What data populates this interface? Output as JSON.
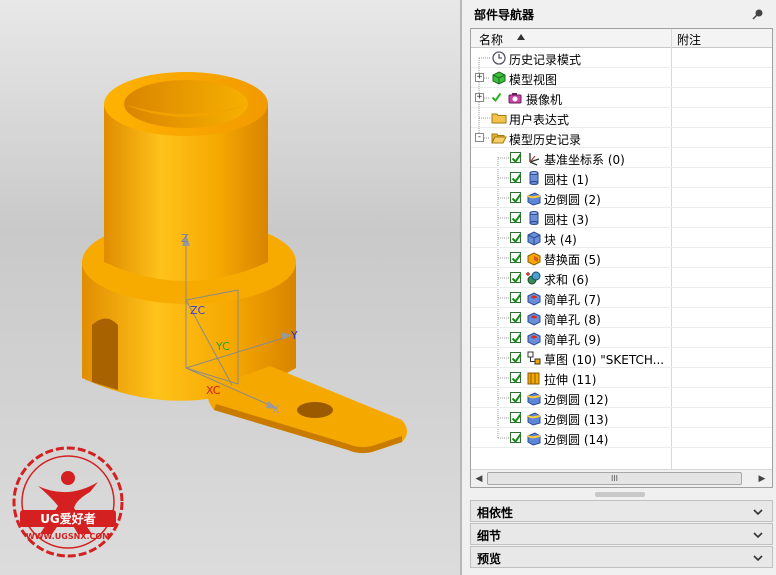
{
  "panel": {
    "title": "部件导航器",
    "columns": {
      "name": "名称",
      "note": "附注"
    },
    "tree": [
      {
        "label": "历史记录模式",
        "icon": "clock-icon"
      },
      {
        "label": "模型视图",
        "icon": "model-views-icon",
        "expander": "+"
      },
      {
        "label": "摄像机",
        "icon": "camera-icon",
        "expander": "+",
        "check": true
      },
      {
        "label": "用户表达式",
        "icon": "folder-icon"
      },
      {
        "label": "模型历史记录",
        "icon": "open-folder-icon",
        "expander": "-"
      },
      {
        "label": "基准坐标系 (0)",
        "icon": "datum-csys-icon",
        "check": true
      },
      {
        "label": "圆柱 (1)",
        "icon": "cylinder-icon",
        "check": true
      },
      {
        "label": "边倒圆 (2)",
        "icon": "edge-blend-icon",
        "check": true
      },
      {
        "label": "圆柱 (3)",
        "icon": "cylinder-icon",
        "check": true
      },
      {
        "label": "块 (4)",
        "icon": "block-icon",
        "check": true
      },
      {
        "label": "替换面 (5)",
        "icon": "replace-face-icon",
        "check": true
      },
      {
        "label": "求和 (6)",
        "icon": "unite-icon",
        "check": true
      },
      {
        "label": "简单孔 (7)",
        "icon": "hole-icon",
        "check": true
      },
      {
        "label": "简单孔 (8)",
        "icon": "hole-icon",
        "check": true
      },
      {
        "label": "简单孔 (9)",
        "icon": "hole-icon",
        "check": true
      },
      {
        "label": "草图 (10) \"SKETCH...",
        "icon": "sketch-icon",
        "check": true
      },
      {
        "label": "拉伸 (11)",
        "icon": "extrude-icon",
        "check": true
      },
      {
        "label": "边倒圆 (12)",
        "icon": "edge-blend-icon",
        "check": true
      },
      {
        "label": "边倒圆 (13)",
        "icon": "edge-blend-icon",
        "check": true
      },
      {
        "label": "边倒圆 (14)",
        "icon": "edge-blend-icon",
        "check": true
      }
    ],
    "scrollbar_grip": "III",
    "sections": [
      "相依性",
      "细节",
      "预览"
    ]
  },
  "viewport": {
    "axes": {
      "z": "Z",
      "zc": "ZC",
      "yc": "YC",
      "y": "Y",
      "xc": "XC",
      "x": "X"
    },
    "model_color": "#f5a800"
  },
  "watermark": {
    "brand": "UG爱好者",
    "url": "WWW.UGSNX.COM"
  }
}
